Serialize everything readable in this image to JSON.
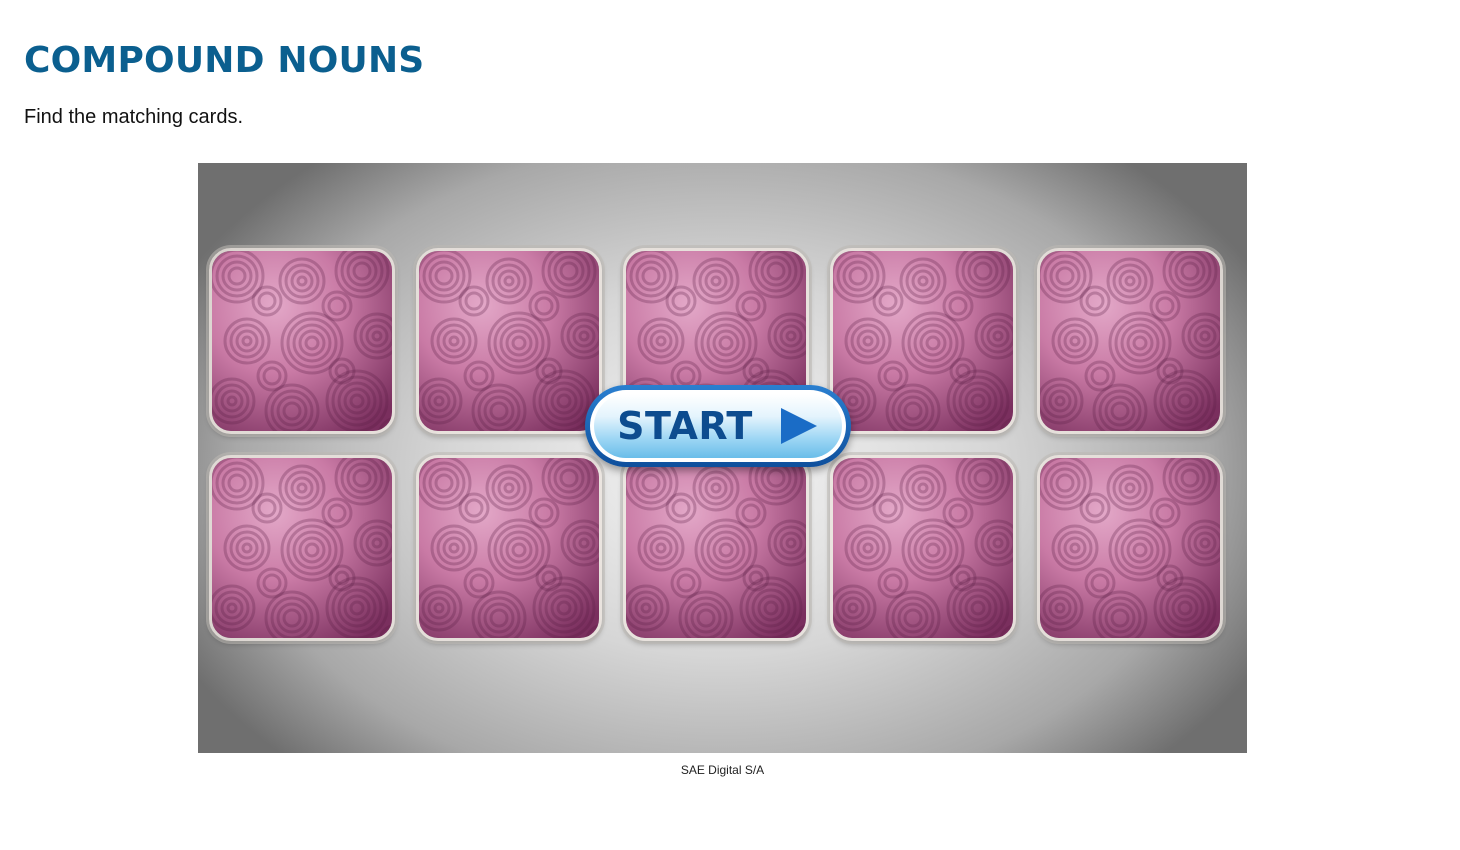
{
  "page": {
    "title": "COMPOUND NOUNS",
    "instructions": "Find the matching cards."
  },
  "game": {
    "start_label": "START",
    "start_icon": "play-icon",
    "cards": [
      {
        "state": "face-down"
      },
      {
        "state": "face-down"
      },
      {
        "state": "face-down"
      },
      {
        "state": "face-down"
      },
      {
        "state": "face-down"
      },
      {
        "state": "face-down"
      },
      {
        "state": "face-down"
      },
      {
        "state": "face-down"
      },
      {
        "state": "face-down"
      },
      {
        "state": "face-down"
      }
    ],
    "card_back_colors": [
      "#c97aa5",
      "#7a2f5e"
    ]
  },
  "caption": "SAE Digital S/A",
  "colors": {
    "title": "#0b5f8f",
    "start_text": "#0d4c8f",
    "start_border": "#1a66b8"
  }
}
